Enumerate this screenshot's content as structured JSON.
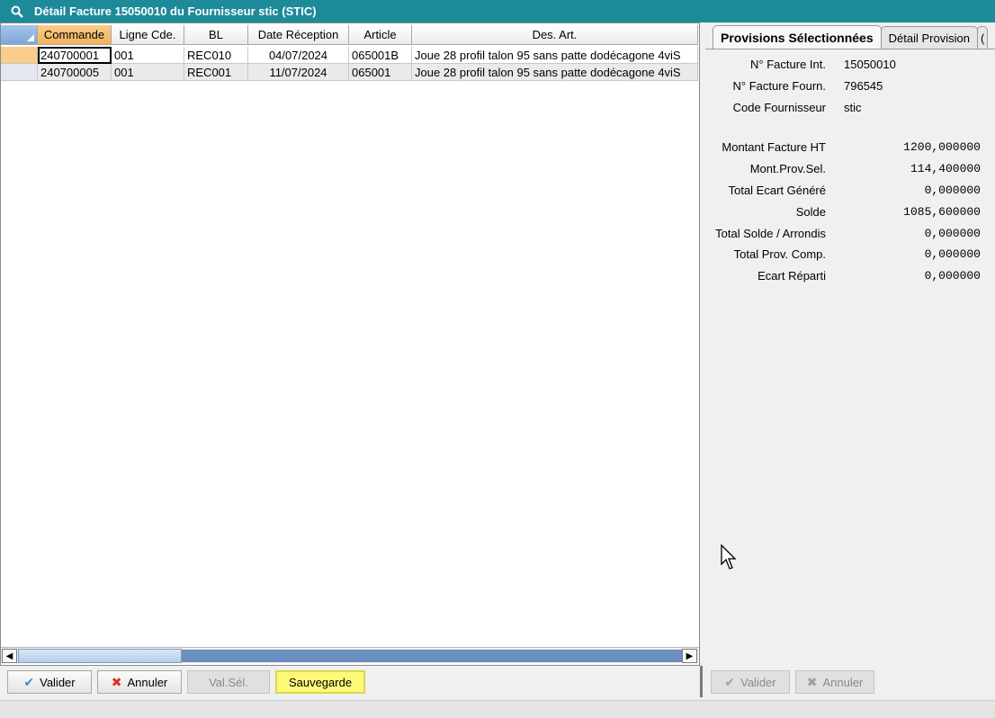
{
  "window": {
    "title": "Détail Facture 15050010 du Fournisseur stic (STIC)"
  },
  "grid": {
    "columns": [
      {
        "label": "Commande",
        "width": 82
      },
      {
        "label": "Ligne Cde.",
        "width": 81
      },
      {
        "label": "BL",
        "width": 71
      },
      {
        "label": "Date Réception",
        "width": 112
      },
      {
        "label": "Article",
        "width": 70
      },
      {
        "label": "Des. Art.",
        "width": 318
      }
    ],
    "rows": [
      [
        "240700001",
        "001",
        "REC010",
        "04/07/2024",
        "065001B",
        "Joue 28 profil talon 95 sans patte dodécagone 4viS"
      ],
      [
        "240700005",
        "001",
        "REC001",
        "11/07/2024",
        "065001",
        "Joue 28 profil talon 95 sans patte dodécagone 4viS"
      ]
    ]
  },
  "left_buttons": {
    "valider": "Valider",
    "annuler": "Annuler",
    "valsel": "Val.Sél.",
    "sauvegarde": "Sauvegarde"
  },
  "tabs": [
    "Provisions Sélectionnées",
    "Détail Provision",
    "("
  ],
  "info": [
    {
      "label": "N° Facture Int.",
      "value": "15050010"
    },
    {
      "label": "N° Facture Fourn.",
      "value": "796545"
    },
    {
      "label": "Code Fournisseur",
      "value": "stic"
    }
  ],
  "amounts": [
    {
      "label": "Montant Facture HT",
      "value": "1200,000000"
    },
    {
      "label": "Mont.Prov.Sel.",
      "value": "114,400000"
    },
    {
      "label": "Total Ecart Généré",
      "value": "0,000000"
    },
    {
      "label": "Solde",
      "value": "1085,600000"
    },
    {
      "label": "Total Solde / Arrondis",
      "value": "0,000000"
    },
    {
      "label": "Total Prov. Comp.",
      "value": "0,000000"
    },
    {
      "label": "Ecart Réparti",
      "value": "0,000000"
    }
  ],
  "right_buttons": {
    "valider": "Valider",
    "annuler": "Annuler"
  },
  "colors": {
    "titlebar": "#1d8a9a",
    "selected_header": "#f3b15a",
    "highlight_button": "#fff97a"
  }
}
